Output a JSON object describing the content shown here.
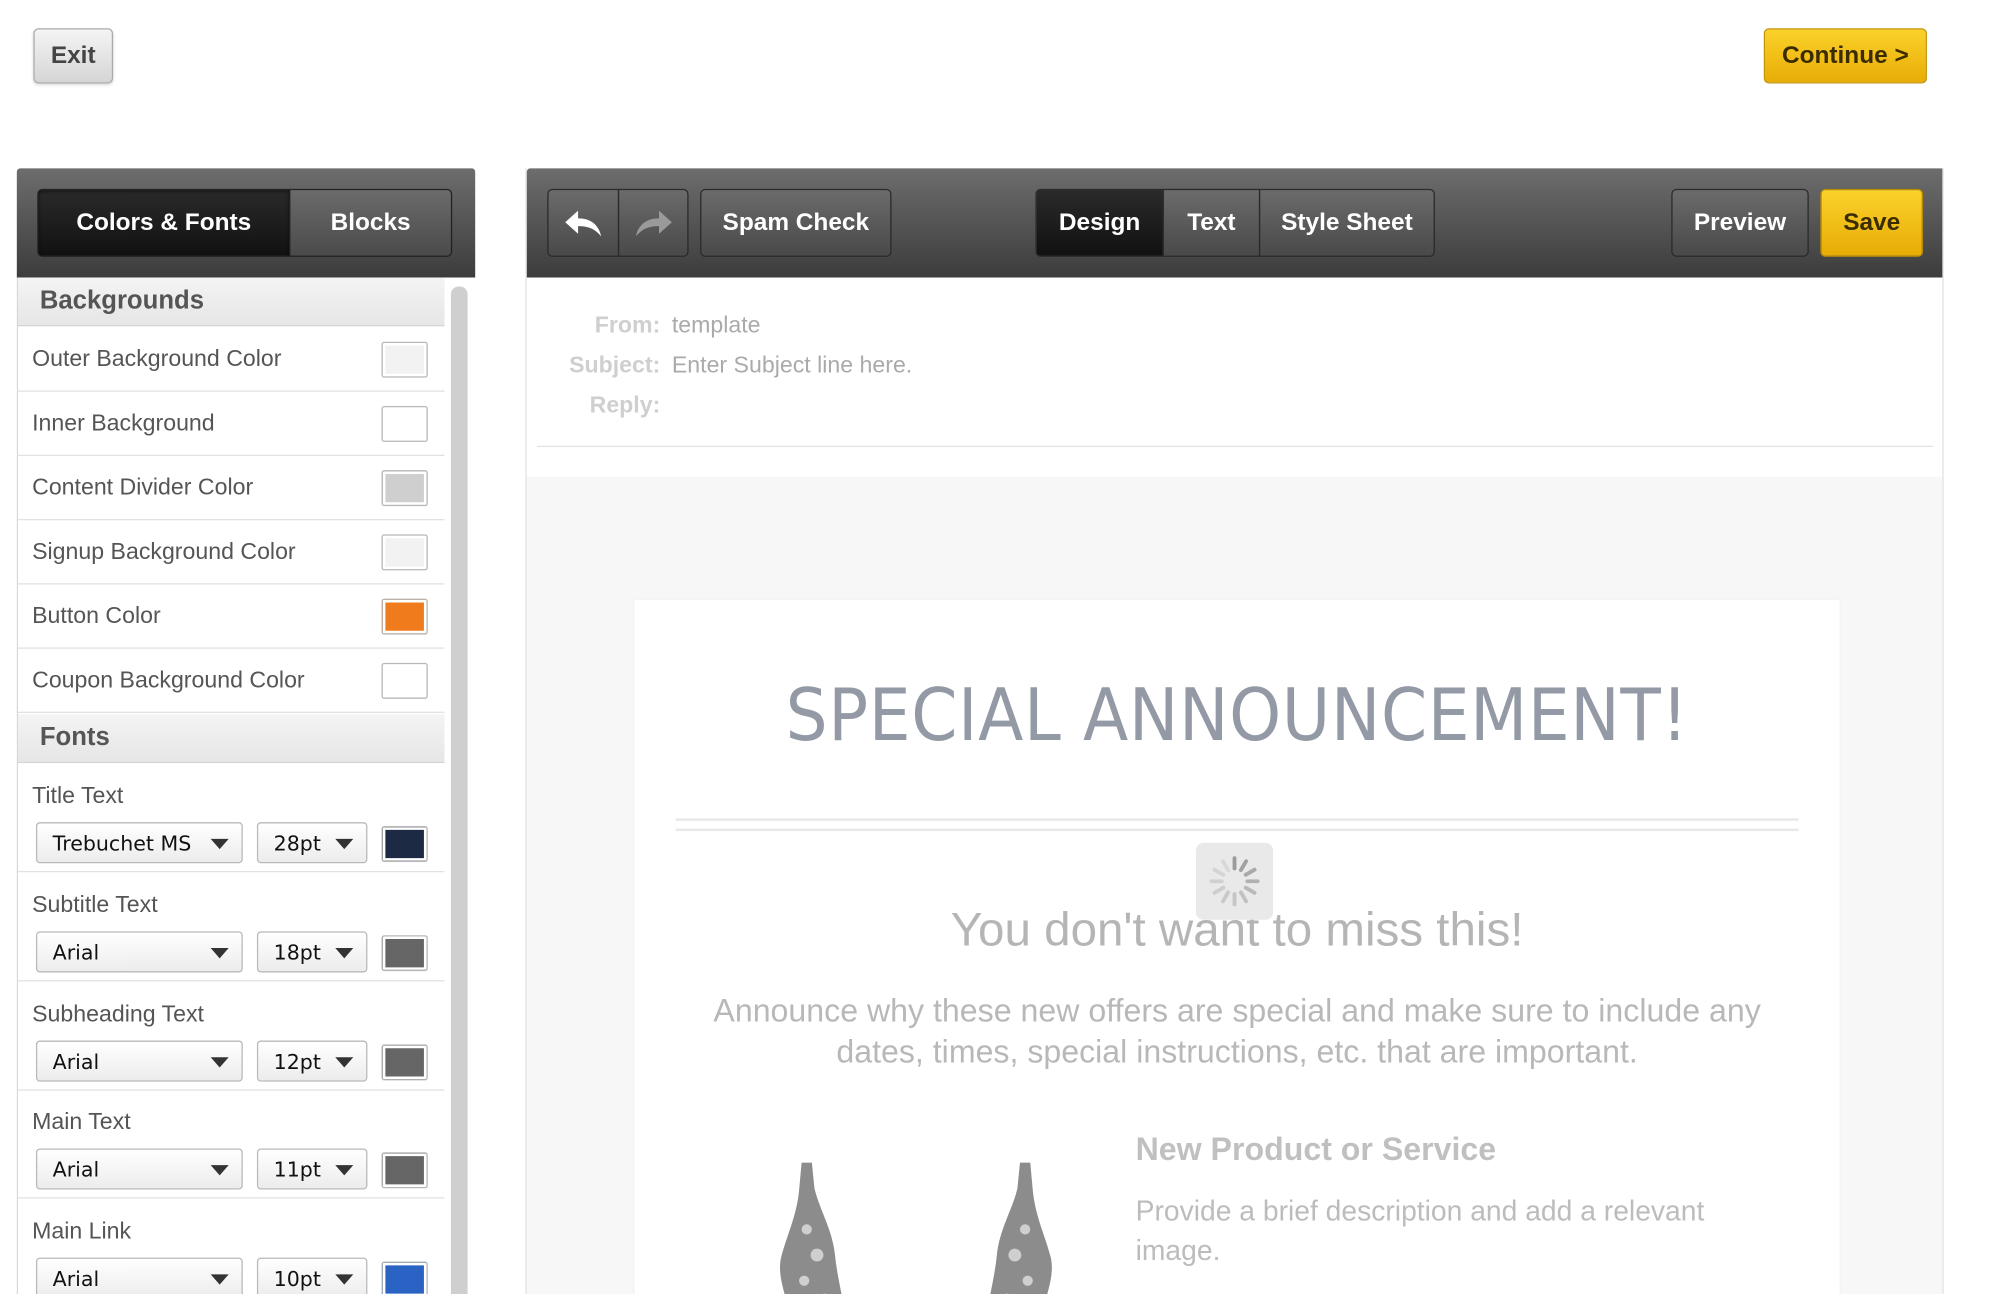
{
  "top": {
    "exit_label": "Exit",
    "continue_label": "Continue >"
  },
  "left_panel": {
    "tabs": [
      {
        "label": "Colors & Fonts",
        "active": true
      },
      {
        "label": "Blocks",
        "active": false
      }
    ],
    "backgrounds_heading": "Backgrounds",
    "color_rows": [
      {
        "label": "Outer Background Color",
        "color": "#f2f2f2"
      },
      {
        "label": "Inner Background",
        "color": "#ffffff"
      },
      {
        "label": "Content Divider Color",
        "color": "#cfcfcf"
      },
      {
        "label": "Signup Background Color",
        "color": "#f2f2f2"
      },
      {
        "label": "Button Color",
        "color": "#f07b1c"
      },
      {
        "label": "Coupon Background Color",
        "color": "#ffffff"
      }
    ],
    "fonts_heading": "Fonts",
    "font_rows": [
      {
        "label": "Title Text",
        "font": "Trebuchet MS",
        "size": "28pt",
        "color": "#1c2a44"
      },
      {
        "label": "Subtitle Text",
        "font": "Arial",
        "size": "18pt",
        "color": "#666666"
      },
      {
        "label": "Subheading Text",
        "font": "Arial",
        "size": "12pt",
        "color": "#666666"
      },
      {
        "label": "Main Text",
        "font": "Arial",
        "size": "11pt",
        "color": "#666666"
      },
      {
        "label": "Main Link",
        "font": "Arial",
        "size": "10pt",
        "color": "#2a63c4"
      }
    ]
  },
  "toolbar": {
    "spam_check_label": "Spam Check",
    "view_tabs": [
      {
        "label": "Design",
        "active": true
      },
      {
        "label": "Text",
        "active": false
      },
      {
        "label": "Style Sheet",
        "active": false
      }
    ],
    "preview_label": "Preview",
    "save_label": "Save"
  },
  "meta": {
    "from_label": "From:",
    "from_value": "template",
    "subject_label": "Subject:",
    "subject_value": "Enter Subject line here.",
    "reply_label": "Reply:"
  },
  "email": {
    "title": "SPECIAL ANNOUNCEMENT!",
    "subtitle": "You don't want to miss this!",
    "body": "Announce why these new offers are special and make sure to include any dates, times, special instructions, etc. that are important.",
    "product_title": "New Product or Service",
    "product_desc": "Provide a brief description and add a relevant image."
  }
}
